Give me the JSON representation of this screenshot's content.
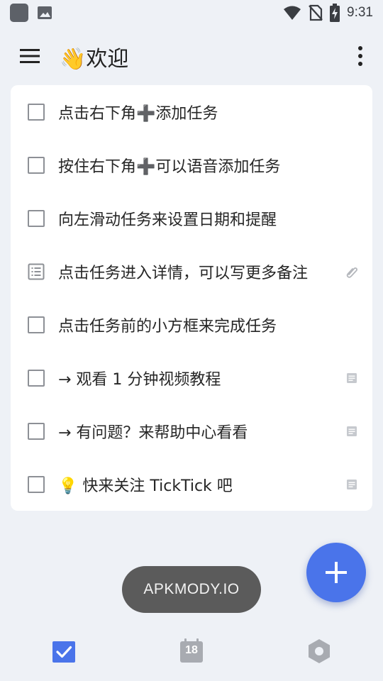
{
  "status_bar": {
    "time": "9:31",
    "icons": [
      "app-icon",
      "image-icon",
      "wifi-icon",
      "no-sim-icon",
      "battery-charging-icon"
    ]
  },
  "header": {
    "title": "👋欢迎",
    "menu_icon": "hamburger-menu-icon",
    "more_icon": "more-vertical-icon"
  },
  "tasks": [
    {
      "text": "点击右下角➕添加任务",
      "type": "checkbox",
      "right_icon": ""
    },
    {
      "text": "按住右下角➕可以语音添加任务",
      "type": "checkbox",
      "right_icon": ""
    },
    {
      "text": "向左滑动任务来设置日期和提醒",
      "type": "checkbox",
      "right_icon": ""
    },
    {
      "text": "点击任务进入详情，可以写更多备注",
      "type": "note",
      "right_icon": "attachment-icon"
    },
    {
      "text": "点击任务前的小方框来完成任务",
      "type": "checkbox",
      "right_icon": ""
    },
    {
      "text": "→ 观看 1 分钟视频教程",
      "type": "checkbox",
      "right_icon": "note-icon"
    },
    {
      "text": "→ 有问题？来帮助中心看看",
      "type": "checkbox",
      "right_icon": "note-icon"
    },
    {
      "text": "💡 快来关注 TickTick 吧",
      "type": "checkbox",
      "right_icon": "note-icon"
    }
  ],
  "fab": {
    "icon": "plus-icon",
    "color": "#4a74ea"
  },
  "toast": {
    "text": "APKMODY.IO"
  },
  "bottom_nav": {
    "calendar_day": "18",
    "items": [
      "tasks-checkbox-icon",
      "calendar-icon",
      "settings-hexagon-icon"
    ],
    "active_color": "#4a74ea",
    "inactive_color": "#a8abb1"
  }
}
